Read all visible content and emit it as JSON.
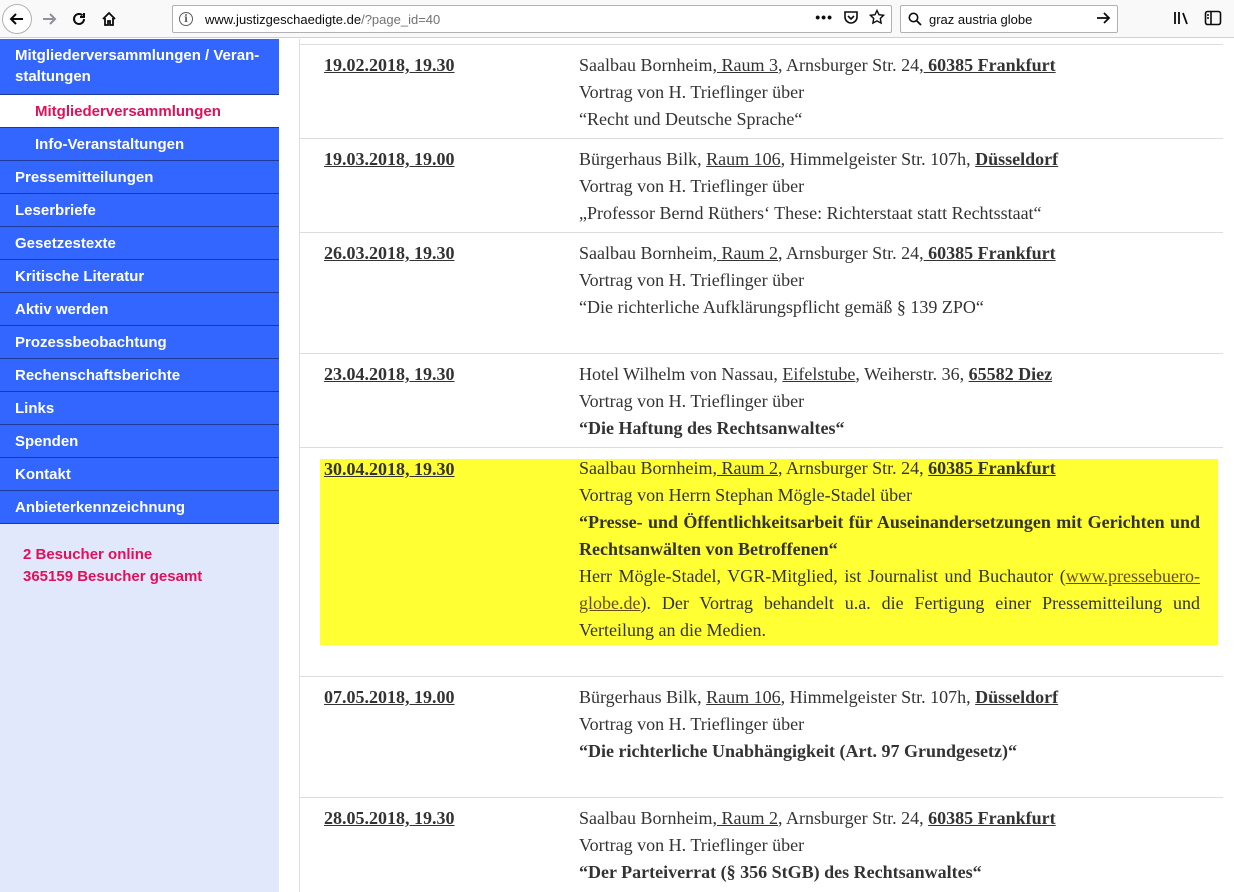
{
  "browser": {
    "url_host": "www.justizgeschaedigte.de",
    "url_path": "/?page_id=40",
    "search_query": "graz austria globe"
  },
  "sidebar": {
    "items": [
      {
        "label": "Mitgliederversammlungen / Veran-staltungen",
        "line1": "Mitgliederversammlungen / Veran-",
        "line2": "staltungen"
      },
      {
        "label": "Mitgliederversammlungen"
      },
      {
        "label": "Info-Veranstaltungen"
      },
      {
        "label": "Pressemitteilungen"
      },
      {
        "label": "Leserbriefe"
      },
      {
        "label": "Gesetzestexte"
      },
      {
        "label": "Kritische Literatur"
      },
      {
        "label": "Aktiv werden"
      },
      {
        "label": "Prozessbeobachtung"
      },
      {
        "label": "Rechenschaftsberichte"
      },
      {
        "label": "Links"
      },
      {
        "label": "Spenden"
      },
      {
        "label": "Kontakt"
      },
      {
        "label": "Anbieterkennzeichnung"
      }
    ],
    "visitors_online": "2 Besucher online",
    "visitors_total": "365159 Besucher gesamt"
  },
  "events": [
    {
      "date": "19.02.2018, 19.30",
      "venue": "Saalbau Bornheim,",
      "room": " Raum 3",
      "address": ", Arnsburger Str. 24,",
      "city": " 60385 Frankfurt",
      "speaker": "Vortrag von H. Trieflinger über",
      "topic": "“Recht und Deutsche Sprache“"
    },
    {
      "date": "19.03.2018, 19.00",
      "venue": "Bürgerhaus Bilk, ",
      "room": "Raum 106",
      "address": ", Himmelgeister Str. 107h, ",
      "city": "Düsseldorf",
      "speaker": "Vortrag von H. Trieflinger über",
      "topic": "„Professor Bernd Rüthers‘ These: Richterstaat statt Rechtsstaat“"
    },
    {
      "date": "26.03.2018, 19.30",
      "venue": "Saalbau Bornheim,",
      "room": " Raum 2",
      "address": ", Arnsburger Str. 24,",
      "city": " 60385 Frankfurt",
      "speaker": "Vortrag von H. Trieflinger über",
      "topic": "“Die richterliche Aufklärungspflicht gemäß § 139 ZPO“"
    },
    {
      "date": "23.04.2018, 19.30",
      "venue": "Hotel Wilhelm von Nassau, ",
      "room": "Eifelstube",
      "address": ", Weiherstr. 36, ",
      "city": "65582 Diez",
      "speaker": "Vortrag von H. Trieflinger über",
      "topic": "“Die Haftung des Rechtsanwaltes“"
    },
    {
      "date": "30.04.2018, 19.30",
      "venue": "Saalbau Bornheim,",
      "room": " Raum 2",
      "address": ", Arnsburger Str. 24, ",
      "city": "60385 Frankfurt",
      "speaker": "Vortrag von Herrn Stephan Mögle-Stadel über",
      "topic": "“Presse- und Öffentlichkeitsarbeit für Auseinandersetzungen mit Gerichten und Rechtsanwälten von Betroffenen“",
      "note_before": "Herr Mögle-Stadel, VGR-Mitglied, ist Journalist und Buchautor (",
      "note_link": "www.pressebuero-globe.de",
      "note_after": "). Der Vortrag behandelt u.a. die Fertigung einer Pressemitteilung und Verteilung an die Medien.",
      "highlight_color": "#ffff33"
    },
    {
      "date": "07.05.2018, 19.00",
      "venue": "Bürgerhaus Bilk, ",
      "room": "Raum 106",
      "address": ", Himmelgeister Str. 107h, ",
      "city": "Düsseldorf",
      "speaker": "Vortrag von H. Trieflinger über",
      "topic": "“Die richterliche Unabhängigkeit (Art. 97 Grundgesetz)“"
    },
    {
      "date": "28.05.2018, 19.30",
      "venue": "Saalbau Bornheim,",
      "room": " Raum 2",
      "address": ", Arnsburger Str. 24, ",
      "city": "60385 Frankfurt",
      "speaker": "Vortrag von H. Trieflinger über",
      "topic": "“Der Parteiverrat (§ 356 StGB) des Rechtsanwaltes“"
    }
  ],
  "colors": {
    "menu_bg": "#3366ff",
    "menu_active_text": "#e0105a",
    "sidebar_bg": "#e2e8fb",
    "highlight": "#ffff33"
  }
}
